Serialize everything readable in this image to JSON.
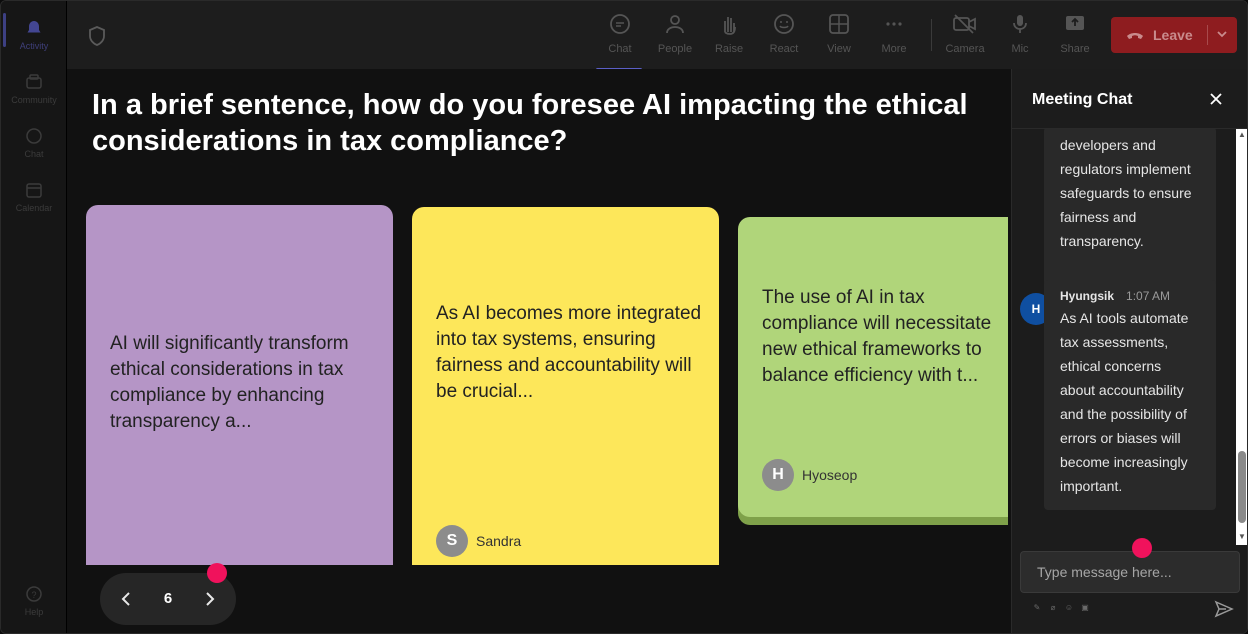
{
  "rail": {
    "items": [
      {
        "label": "Activity"
      },
      {
        "label": "Community"
      },
      {
        "label": "Chat"
      },
      {
        "label": "Calendar"
      },
      {
        "label": "Help"
      }
    ]
  },
  "toolbar": {
    "buttons": [
      {
        "label": "Chat"
      },
      {
        "label": "People"
      },
      {
        "label": "Raise"
      },
      {
        "label": "React"
      },
      {
        "label": "View"
      },
      {
        "label": "More"
      },
      {
        "label": "Camera"
      },
      {
        "label": "Mic"
      },
      {
        "label": "Share"
      }
    ],
    "leave_label": "Leave"
  },
  "main": {
    "question": "In a brief sentence, how do you foresee AI impacting the ethical considerations in tax compliance?",
    "cards": [
      {
        "text": "AI will significantly transform ethical considerations in tax compliance by enhancing transparency a...",
        "author": "",
        "color": "#b595c6"
      },
      {
        "text": "As AI becomes more integrated into tax systems, ensuring fairness and accountability will be crucial...",
        "author": "Sandra",
        "initial": "S",
        "color": "#fde75a"
      },
      {
        "text": "The use of AI in tax compliance will necessitate new ethical frameworks to balance efficiency with t...",
        "author": "Hyoseop",
        "initial": "H",
        "color": "#b0d57a"
      }
    ],
    "page_number": "6"
  },
  "chat": {
    "title": "Meeting Chat",
    "messages": [
      {
        "text_lines": [
          "developers and",
          "regulators implement",
          "safeguards to ensure",
          "fairness and",
          "transparency."
        ]
      },
      {
        "sender": "Hyungsik",
        "initial": "H",
        "time": "1:07 AM",
        "text_lines": [
          "As AI tools automate",
          "tax assessments,",
          "ethical concerns",
          "about accountability",
          "and the possibility of",
          "errors or biases will",
          "become increasingly",
          "important."
        ]
      }
    ],
    "input_placeholder": "Type message here..."
  },
  "colors": {
    "accent": "#5b5fc7",
    "leave": "#8e1c1f",
    "highlight_dot": "#f0125c"
  }
}
